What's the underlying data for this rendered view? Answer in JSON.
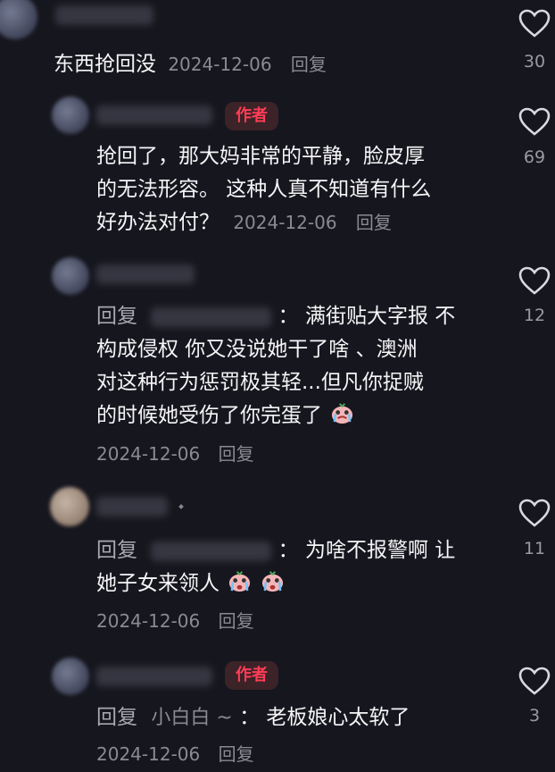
{
  "colors": {
    "background": "#16161e",
    "author_badge": "#ff3d56",
    "meta": "#8a8a94"
  },
  "comments": [
    {
      "text": "东西抢回没",
      "date": "2024-12-06",
      "reply": "回复",
      "likes": "30"
    },
    {
      "badge": "作者",
      "lines": [
        "抢回了，那大妈非常的平静，脸皮厚",
        "的无法形容。 这种人真不知道有什么",
        "好办法对付？"
      ],
      "date": "2024-12-06",
      "reply": "回复",
      "likes": "69"
    },
    {
      "prefix": "回复",
      "sep": "：",
      "lines": [
        "满街贴大字报 不",
        "构成侵权 你又没说她干了啥 、澳洲",
        "对这种行为惩罚极其轻...但凡你捉贼",
        "的时候她受伤了你完蛋了"
      ],
      "date": "2024-12-06",
      "reply": "回复",
      "likes": "12",
      "emoji": "cry-emoji"
    },
    {
      "prefix": "回复",
      "sep": "：",
      "lines": [
        "为啥不报警啊 让",
        "她子女来领人"
      ],
      "date": "2024-12-06",
      "reply": "回复",
      "likes": "11",
      "emoji": "sob-emoji"
    },
    {
      "badge": "作者",
      "prefix": "回复",
      "target": "小白白 ~",
      "sep": "：",
      "text": "老板娘心太软了",
      "date": "2024-12-06",
      "reply": "回复",
      "likes": "3"
    }
  ]
}
